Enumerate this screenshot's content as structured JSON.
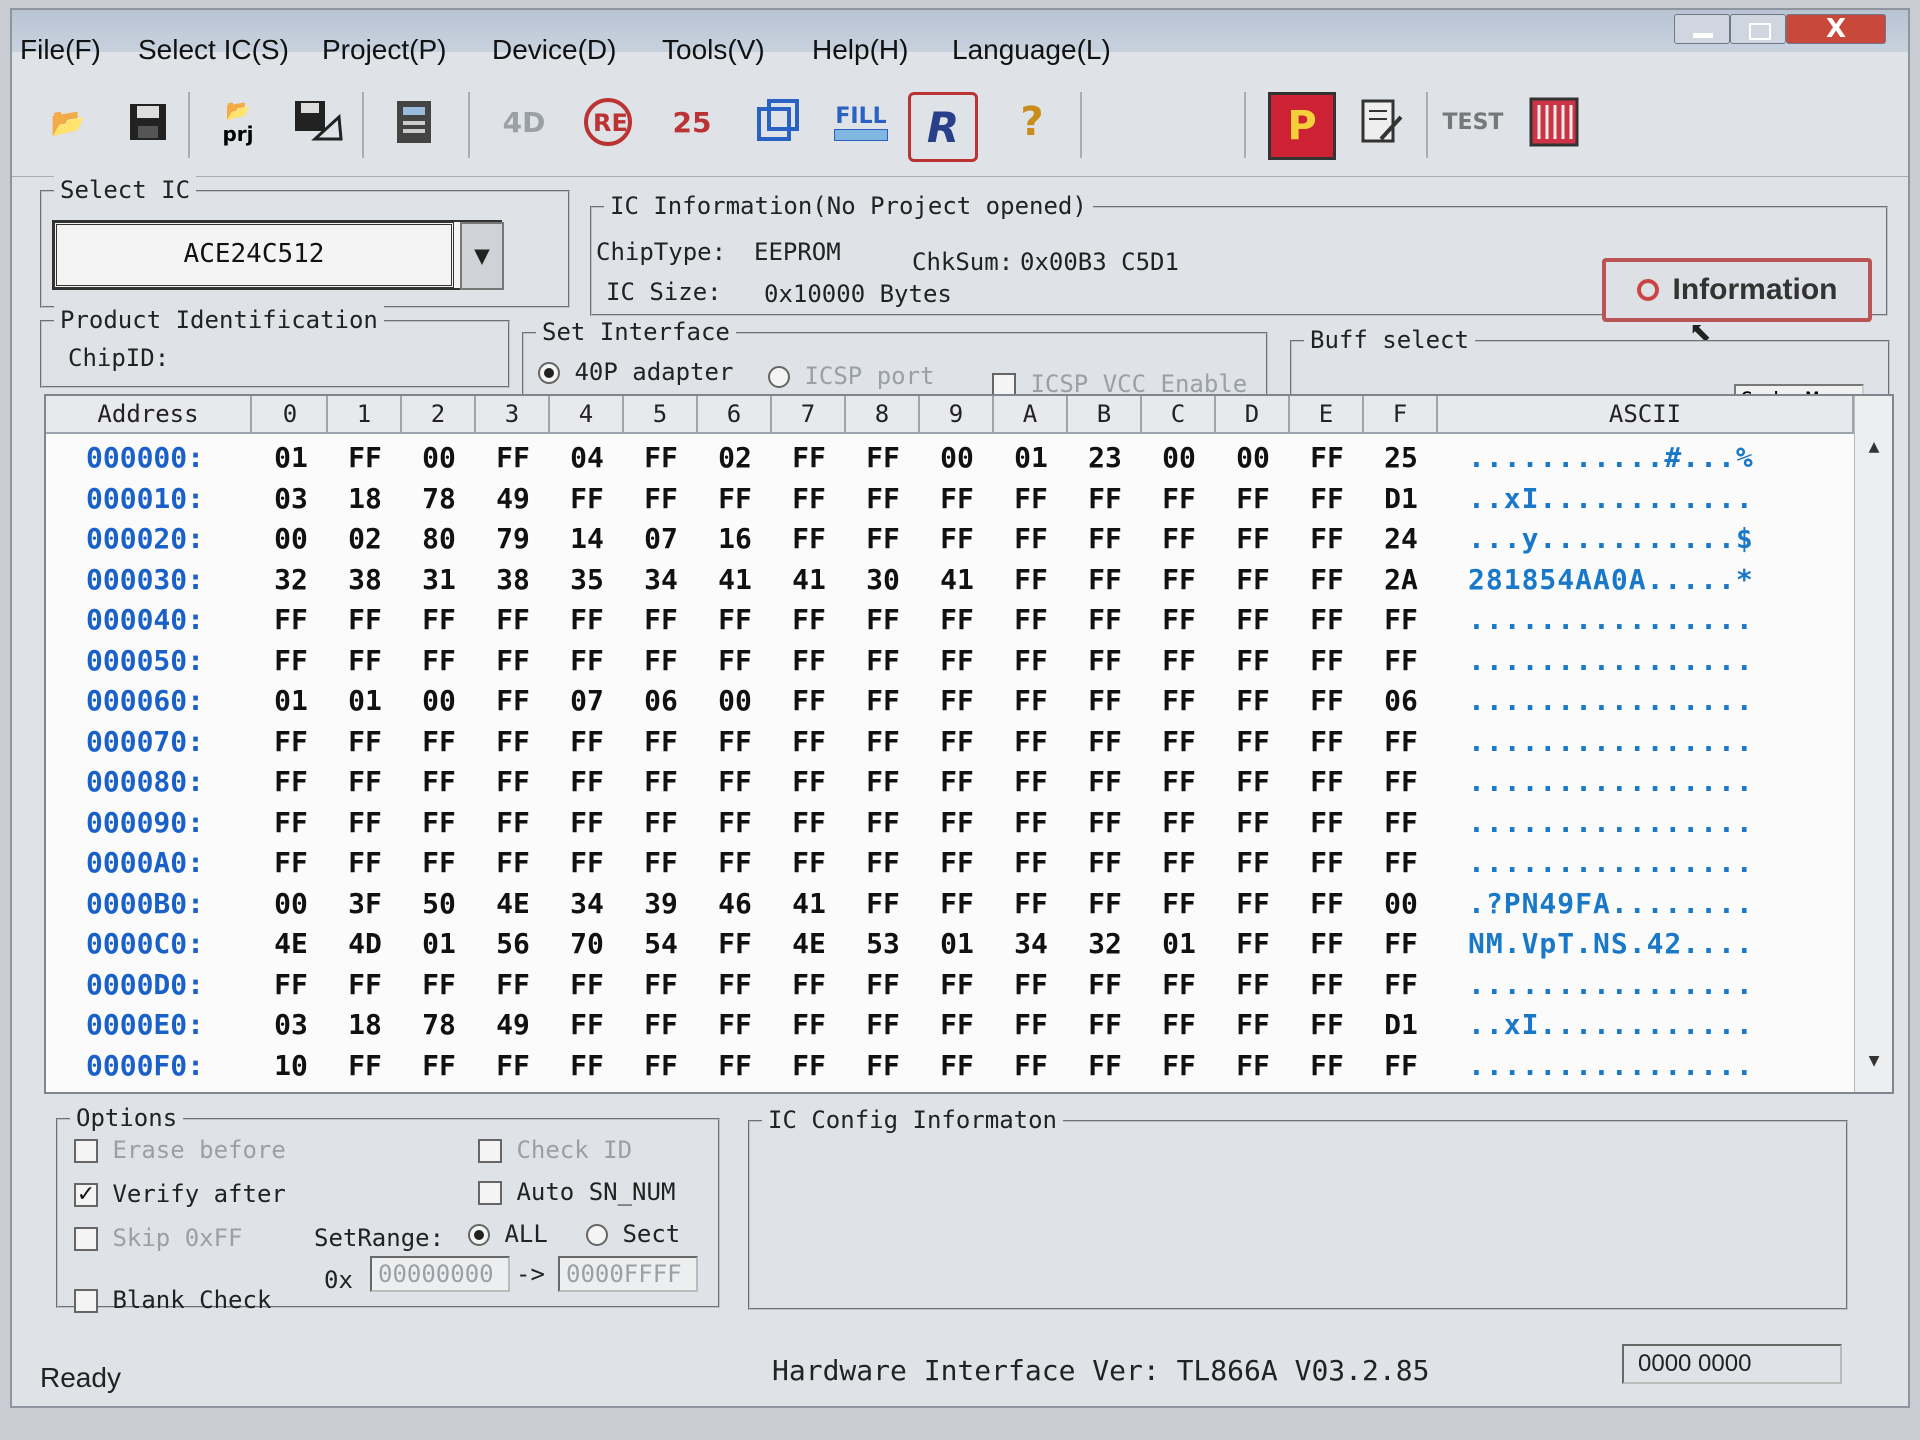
{
  "menu": [
    "File(F)",
    "Select IC(S)",
    "Project(P)",
    "Device(D)",
    "Tools(V)",
    "Help(H)",
    "Language(L)"
  ],
  "toolbar": {
    "icons": [
      "open-file-icon",
      "save-icon",
      "open-project-icon",
      "save-project-icon",
      "chip-save-icon",
      "read-id-icon",
      "erase-icon",
      "verify-icon",
      "program-icon",
      "fill-icon",
      "read-icon",
      "help-icon",
      "program-p-icon",
      "edit-icon",
      "test-icon",
      "chip-icon"
    ],
    "labels": {
      "read_id": "4D",
      "verify": "25",
      "fill": "FILL",
      "read": "R",
      "prj": "prj",
      "test": "TEST",
      "program": "P"
    }
  },
  "window_close": "X",
  "select_ic": {
    "label": "Select IC",
    "value": "ACE24C512"
  },
  "ic_info": {
    "label": "IC Information(No Project opened)",
    "chiptype_label": "ChipType:",
    "chiptype": "EEPROM",
    "chksum_label": "ChkSum:",
    "chksum": "0x00B3 C5D1",
    "size_label": "IC Size:",
    "size": "0x10000 Bytes",
    "button": "Information"
  },
  "product_id": {
    "label": "Product Identification",
    "chipid_label": "ChipID:"
  },
  "set_interface": {
    "label": "Set Interface",
    "adapter": "40P adapter",
    "icsp": "ICSP port",
    "icsp_vcc": "ICSP_VCC Enable"
  },
  "buff_select": {
    "label": "Buff select",
    "code_memo": "Code Memo"
  },
  "hex": {
    "address_header": "Address",
    "col_headers": [
      "0",
      "1",
      "2",
      "3",
      "4",
      "5",
      "6",
      "7",
      "8",
      "9",
      "A",
      "B",
      "C",
      "D",
      "E",
      "F"
    ],
    "ascii_header": "ASCII",
    "rows": [
      {
        "addr": "000000:",
        "bytes": [
          "01",
          "FF",
          "00",
          "FF",
          "04",
          "FF",
          "02",
          "FF",
          "FF",
          "00",
          "01",
          "23",
          "00",
          "00",
          "FF",
          "25"
        ],
        "ascii": "...........#...%"
      },
      {
        "addr": "000010:",
        "bytes": [
          "03",
          "18",
          "78",
          "49",
          "FF",
          "FF",
          "FF",
          "FF",
          "FF",
          "FF",
          "FF",
          "FF",
          "FF",
          "FF",
          "FF",
          "D1"
        ],
        "ascii": "..xI............"
      },
      {
        "addr": "000020:",
        "bytes": [
          "00",
          "02",
          "80",
          "79",
          "14",
          "07",
          "16",
          "FF",
          "FF",
          "FF",
          "FF",
          "FF",
          "FF",
          "FF",
          "FF",
          "24"
        ],
        "ascii": "...y...........$"
      },
      {
        "addr": "000030:",
        "bytes": [
          "32",
          "38",
          "31",
          "38",
          "35",
          "34",
          "41",
          "41",
          "30",
          "41",
          "FF",
          "FF",
          "FF",
          "FF",
          "FF",
          "2A"
        ],
        "ascii": "281854AA0A.....*"
      },
      {
        "addr": "000040:",
        "bytes": [
          "FF",
          "FF",
          "FF",
          "FF",
          "FF",
          "FF",
          "FF",
          "FF",
          "FF",
          "FF",
          "FF",
          "FF",
          "FF",
          "FF",
          "FF",
          "FF"
        ],
        "ascii": "................"
      },
      {
        "addr": "000050:",
        "bytes": [
          "FF",
          "FF",
          "FF",
          "FF",
          "FF",
          "FF",
          "FF",
          "FF",
          "FF",
          "FF",
          "FF",
          "FF",
          "FF",
          "FF",
          "FF",
          "FF"
        ],
        "ascii": "................"
      },
      {
        "addr": "000060:",
        "bytes": [
          "01",
          "01",
          "00",
          "FF",
          "07",
          "06",
          "00",
          "FF",
          "FF",
          "FF",
          "FF",
          "FF",
          "FF",
          "FF",
          "FF",
          "06"
        ],
        "ascii": "................"
      },
      {
        "addr": "000070:",
        "bytes": [
          "FF",
          "FF",
          "FF",
          "FF",
          "FF",
          "FF",
          "FF",
          "FF",
          "FF",
          "FF",
          "FF",
          "FF",
          "FF",
          "FF",
          "FF",
          "FF"
        ],
        "ascii": "................"
      },
      {
        "addr": "000080:",
        "bytes": [
          "FF",
          "FF",
          "FF",
          "FF",
          "FF",
          "FF",
          "FF",
          "FF",
          "FF",
          "FF",
          "FF",
          "FF",
          "FF",
          "FF",
          "FF",
          "FF"
        ],
        "ascii": "................"
      },
      {
        "addr": "000090:",
        "bytes": [
          "FF",
          "FF",
          "FF",
          "FF",
          "FF",
          "FF",
          "FF",
          "FF",
          "FF",
          "FF",
          "FF",
          "FF",
          "FF",
          "FF",
          "FF",
          "FF"
        ],
        "ascii": "................"
      },
      {
        "addr": "0000A0:",
        "bytes": [
          "FF",
          "FF",
          "FF",
          "FF",
          "FF",
          "FF",
          "FF",
          "FF",
          "FF",
          "FF",
          "FF",
          "FF",
          "FF",
          "FF",
          "FF",
          "FF"
        ],
        "ascii": "................"
      },
      {
        "addr": "0000B0:",
        "bytes": [
          "00",
          "3F",
          "50",
          "4E",
          "34",
          "39",
          "46",
          "41",
          "FF",
          "FF",
          "FF",
          "FF",
          "FF",
          "FF",
          "FF",
          "00"
        ],
        "ascii": ".?PN49FA........"
      },
      {
        "addr": "0000C0:",
        "bytes": [
          "4E",
          "4D",
          "01",
          "56",
          "70",
          "54",
          "FF",
          "4E",
          "53",
          "01",
          "34",
          "32",
          "01",
          "FF",
          "FF",
          "FF"
        ],
        "ascii": "NM.VpT.NS.42...."
      },
      {
        "addr": "0000D0:",
        "bytes": [
          "FF",
          "FF",
          "FF",
          "FF",
          "FF",
          "FF",
          "FF",
          "FF",
          "FF",
          "FF",
          "FF",
          "FF",
          "FF",
          "FF",
          "FF",
          "FF"
        ],
        "ascii": "................"
      },
      {
        "addr": "0000E0:",
        "bytes": [
          "03",
          "18",
          "78",
          "49",
          "FF",
          "FF",
          "FF",
          "FF",
          "FF",
          "FF",
          "FF",
          "FF",
          "FF",
          "FF",
          "FF",
          "D1"
        ],
        "ascii": "..xI............"
      },
      {
        "addr": "0000F0:",
        "bytes": [
          "10",
          "FF",
          "FF",
          "FF",
          "FF",
          "FF",
          "FF",
          "FF",
          "FF",
          "FF",
          "FF",
          "FF",
          "FF",
          "FF",
          "FF",
          "FF"
        ],
        "ascii": "................"
      }
    ]
  },
  "options": {
    "label": "Options",
    "erase_before": "Erase before",
    "verify_after": "Verify after",
    "skip_0xff": "Skip 0xFF",
    "blank_check": "Blank Check",
    "check_id": "Check ID",
    "auto_sn": "Auto SN_NUM",
    "setrange_label": "SetRange:",
    "all": "ALL",
    "sect": "Sect",
    "ox": "0x",
    "range_start": "00000000",
    "arrow": "->",
    "range_end": "0000FFFF"
  },
  "ic_config": {
    "label": "IC Config Informaton"
  },
  "status": {
    "ready": "Ready",
    "hw": "Hardware Interface Ver: TL866A V03.2.85",
    "right": "0000 0000"
  }
}
